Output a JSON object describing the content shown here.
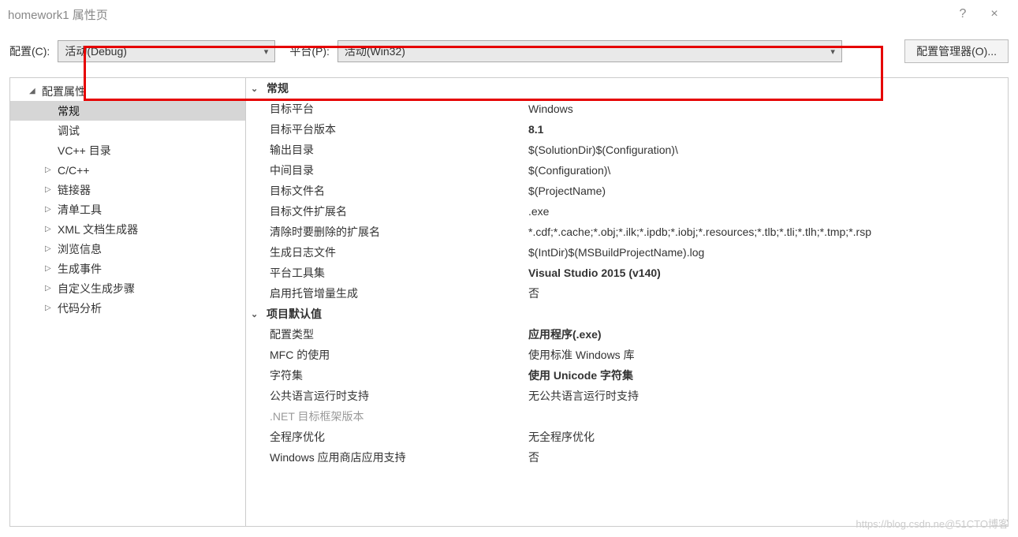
{
  "title": "homework1 属性页",
  "help_tooltip": "?",
  "close_tooltip": "×",
  "config_label": "配置(C):",
  "config_value": "活动(Debug)",
  "platform_label": "平台(P):",
  "platform_value": "活动(Win32)",
  "config_manager_label": "配置管理器(O)...",
  "tree": {
    "root": "配置属性",
    "items": [
      {
        "label": "常规",
        "selected": true
      },
      {
        "label": "调试"
      },
      {
        "label": "VC++ 目录"
      },
      {
        "label": "C/C++",
        "expandable": true
      },
      {
        "label": "链接器",
        "expandable": true
      },
      {
        "label": "清单工具",
        "expandable": true
      },
      {
        "label": "XML 文档生成器",
        "expandable": true
      },
      {
        "label": "浏览信息",
        "expandable": true
      },
      {
        "label": "生成事件",
        "expandable": true
      },
      {
        "label": "自定义生成步骤",
        "expandable": true
      },
      {
        "label": "代码分析",
        "expandable": true
      }
    ]
  },
  "sections": [
    {
      "title": "常规",
      "rows": [
        {
          "name": "目标平台",
          "value": "Windows"
        },
        {
          "name": "目标平台版本",
          "value": "8.1",
          "bold": true
        },
        {
          "name": "输出目录",
          "value": "$(SolutionDir)$(Configuration)\\"
        },
        {
          "name": "中间目录",
          "value": "$(Configuration)\\"
        },
        {
          "name": "目标文件名",
          "value": "$(ProjectName)"
        },
        {
          "name": "目标文件扩展名",
          "value": ".exe"
        },
        {
          "name": "清除时要删除的扩展名",
          "value": "*.cdf;*.cache;*.obj;*.ilk;*.ipdb;*.iobj;*.resources;*.tlb;*.tli;*.tlh;*.tmp;*.rsp"
        },
        {
          "name": "生成日志文件",
          "value": "$(IntDir)$(MSBuildProjectName).log"
        },
        {
          "name": "平台工具集",
          "value": "Visual Studio 2015 (v140)",
          "bold": true
        },
        {
          "name": "启用托管增量生成",
          "value": "否"
        }
      ]
    },
    {
      "title": "项目默认值",
      "rows": [
        {
          "name": "配置类型",
          "value": "应用程序(.exe)",
          "bold": true
        },
        {
          "name": "MFC 的使用",
          "value": "使用标准 Windows 库"
        },
        {
          "name": "字符集",
          "value": "使用 Unicode 字符集",
          "bold": true
        },
        {
          "name": "公共语言运行时支持",
          "value": "无公共语言运行时支持"
        },
        {
          "name": ".NET 目标框架版本",
          "value": "",
          "disabled": true
        },
        {
          "name": "全程序优化",
          "value": "无全程序优化"
        },
        {
          "name": "Windows 应用商店应用支持",
          "value": "否"
        }
      ]
    }
  ],
  "watermark": "https://blog.csdn.ne@51CTO博客"
}
